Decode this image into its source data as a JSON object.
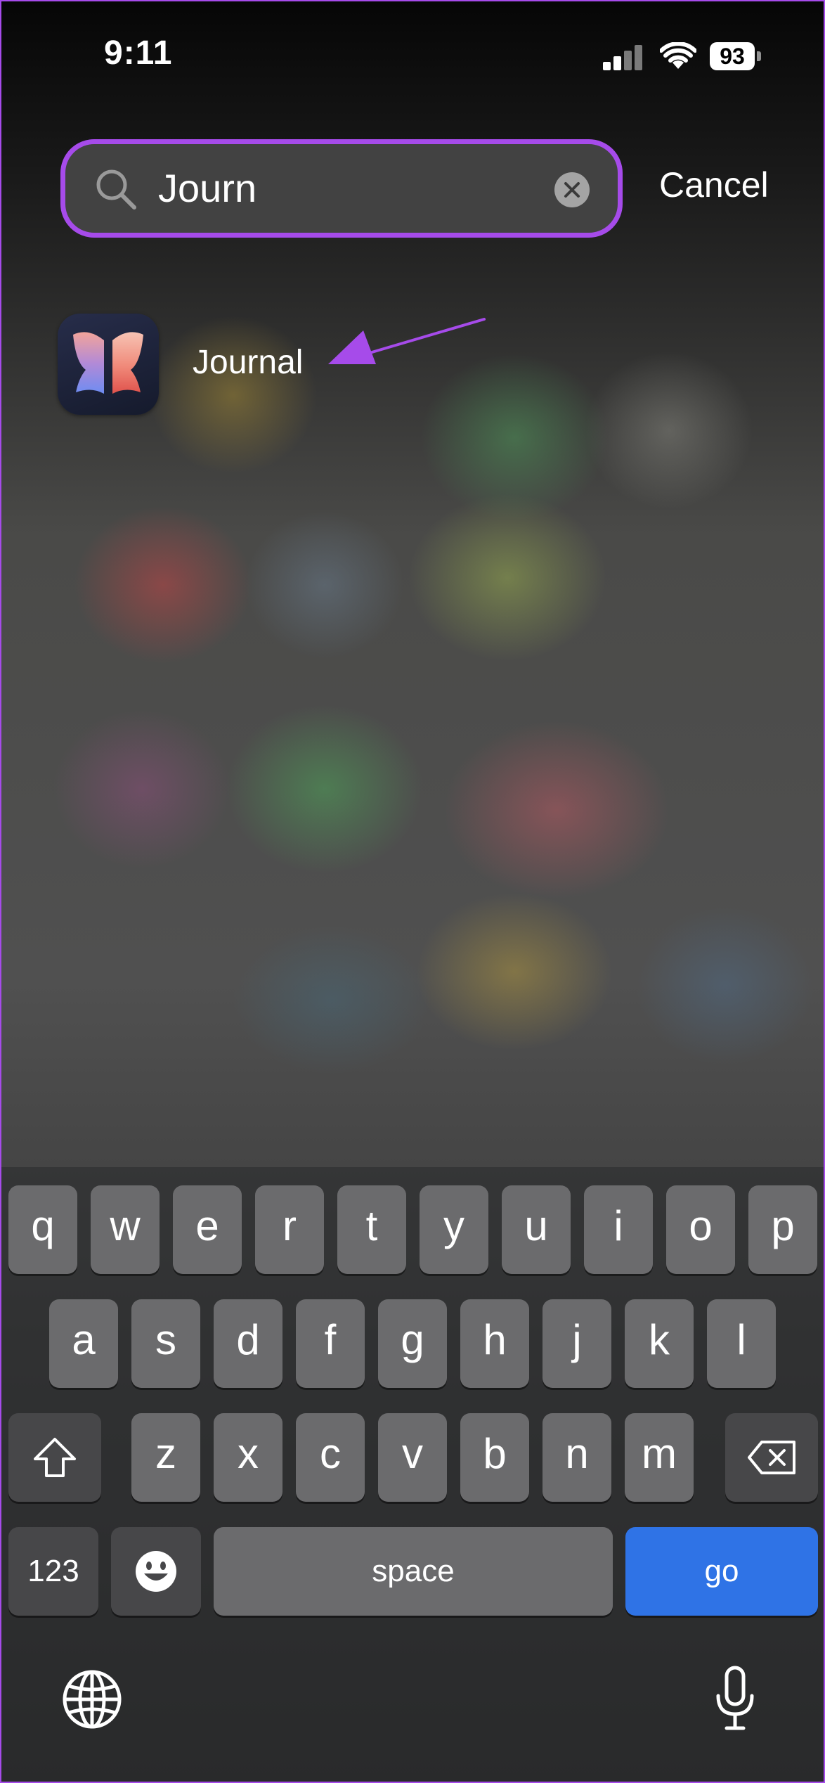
{
  "status_bar": {
    "time": "9:11",
    "battery": "93"
  },
  "search": {
    "query": "Journ",
    "cancel_label": "Cancel"
  },
  "result": {
    "app_name": "Journal"
  },
  "keyboard": {
    "row1": [
      "q",
      "w",
      "e",
      "r",
      "t",
      "y",
      "u",
      "i",
      "o",
      "p"
    ],
    "row2": [
      "a",
      "s",
      "d",
      "f",
      "g",
      "h",
      "j",
      "k",
      "l"
    ],
    "row3": [
      "z",
      "x",
      "c",
      "v",
      "b",
      "n",
      "m"
    ],
    "numbers_label": "123",
    "space_label": "space",
    "go_label": "go"
  },
  "colors": {
    "highlight": "#a64bea",
    "go_key": "#2f73e6"
  },
  "icons": [
    "search-icon",
    "clear-icon",
    "journal-app-icon",
    "arrow-annotation",
    "shift-icon",
    "backspace-icon",
    "emoji-icon",
    "globe-icon",
    "microphone-icon",
    "wifi-icon",
    "signal-icon"
  ]
}
